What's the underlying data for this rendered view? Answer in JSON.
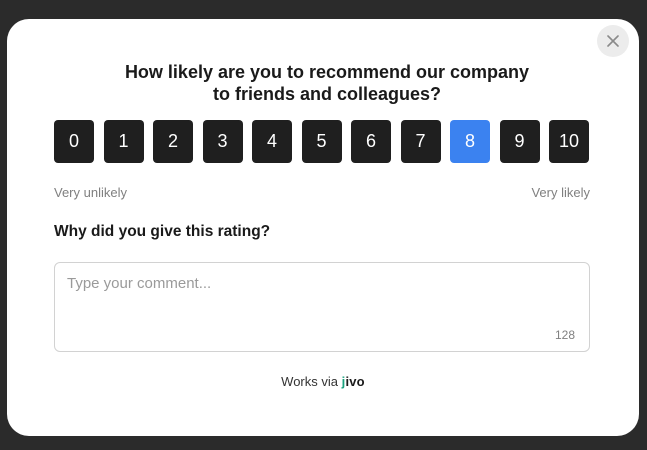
{
  "survey": {
    "title_line1": "How likely are you to recommend our company",
    "title_line2": "to friends and colleagues?",
    "scores": [
      "0",
      "1",
      "2",
      "3",
      "4",
      "5",
      "6",
      "7",
      "8",
      "9",
      "10"
    ],
    "selected_score": "8",
    "low_label": "Very unlikely",
    "high_label": "Very likely",
    "question": "Why did you give this rating?",
    "comment_placeholder": "Type your comment...",
    "comment_value": "",
    "char_counter": "128",
    "footer_prefix": "Works via",
    "footer_brand_j": "j",
    "footer_brand_rest": "ivo"
  },
  "icons": {
    "close": "close-icon"
  },
  "colors": {
    "selected": "#3b82f0",
    "button": "#1f1f1f",
    "brand_accent": "#1aa27e"
  }
}
